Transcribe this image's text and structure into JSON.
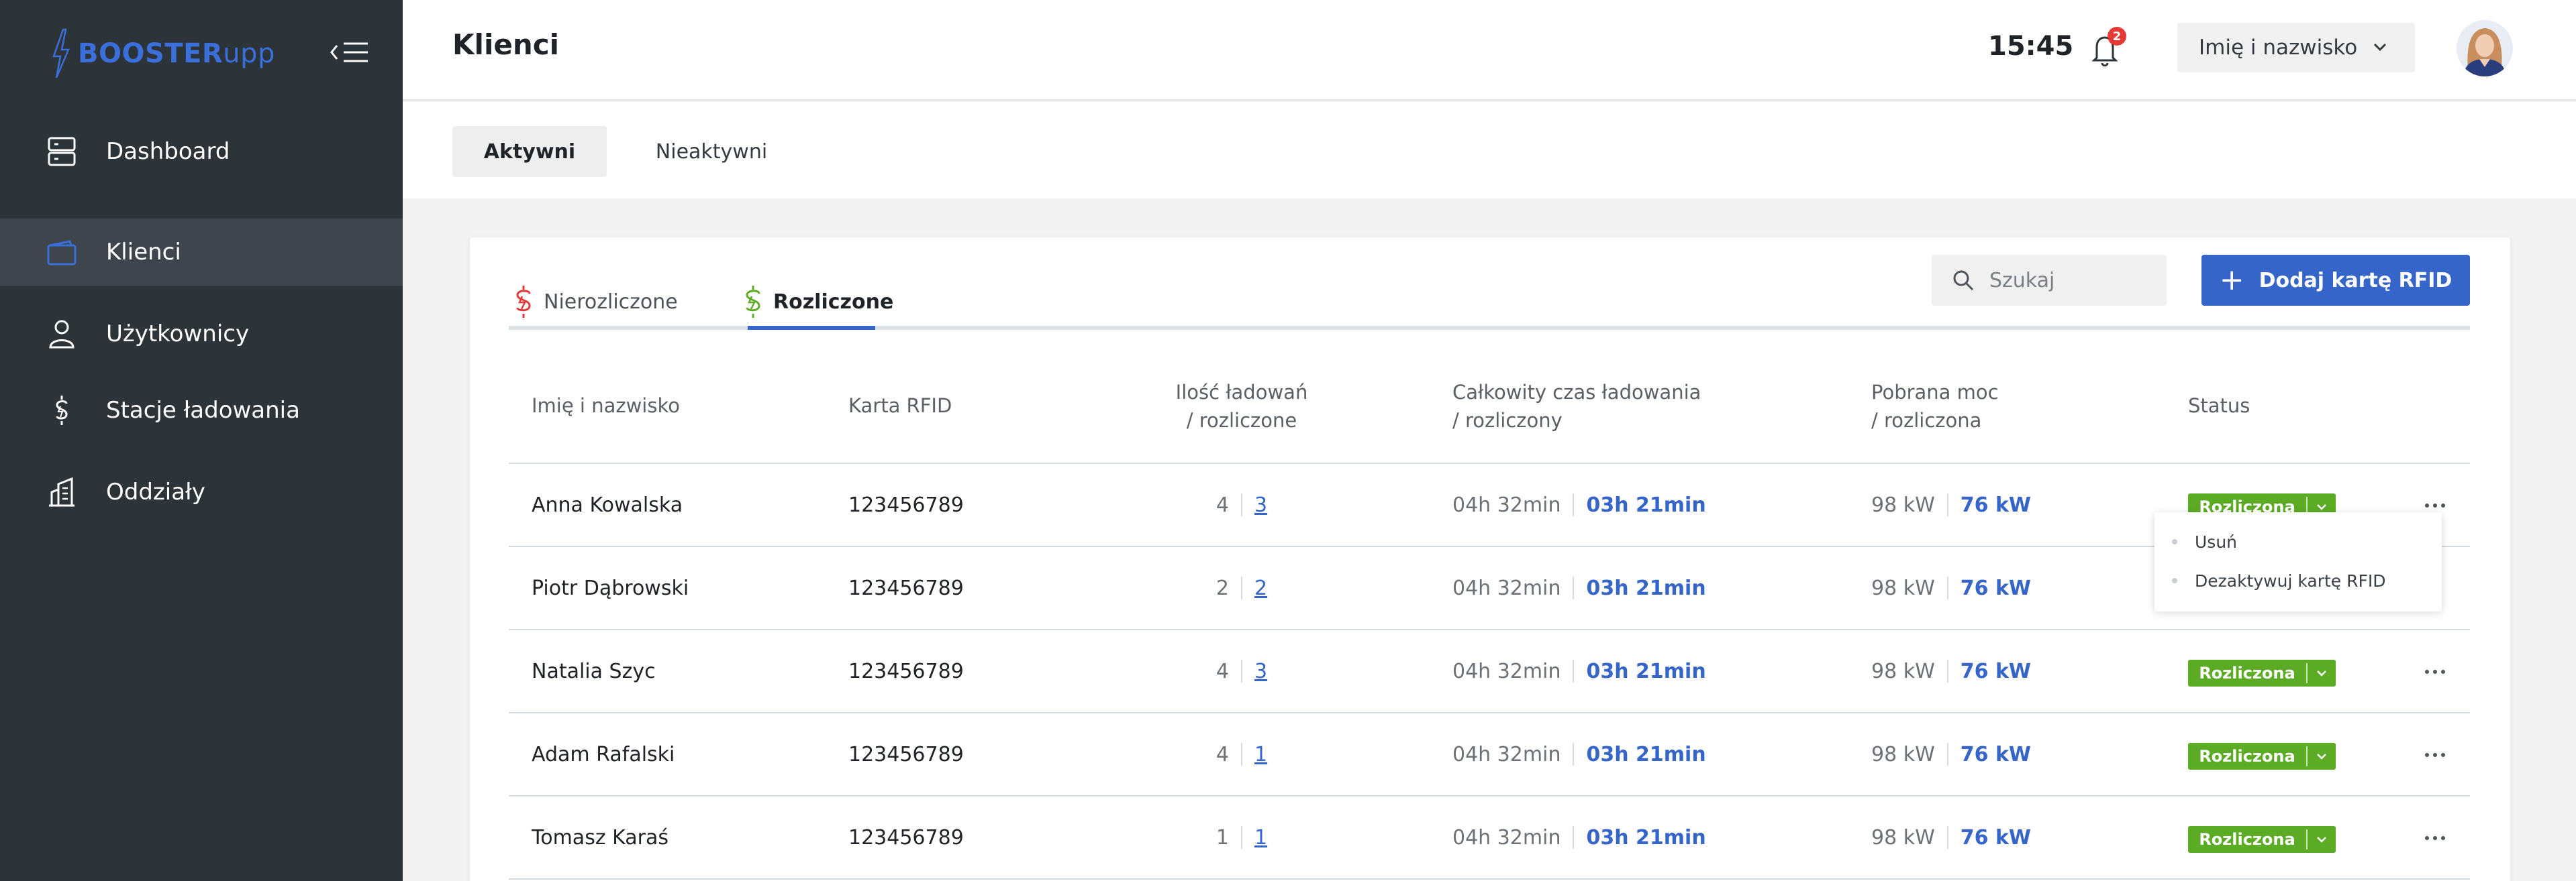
{
  "app": {
    "logo_bold": "BOOSTER",
    "logo_light": "upp"
  },
  "sidebar": {
    "items": [
      {
        "label": "Dashboard",
        "icon": "dashboard-icon"
      },
      {
        "label": "Klienci",
        "icon": "wallet-icon",
        "active": true
      },
      {
        "label": "Użytkownicy",
        "icon": "user-icon"
      },
      {
        "label": "Stacje ładowania",
        "icon": "charging-station-icon"
      },
      {
        "label": "Oddziały",
        "icon": "building-icon"
      }
    ]
  },
  "header": {
    "title": "Klienci",
    "time": "15:45",
    "notification_count": "2",
    "user_select": "Imię i nazwisko"
  },
  "top_tabs": [
    "Aktywni",
    "Nieaktywni"
  ],
  "sub_tabs": [
    {
      "label": "Nierozliczone",
      "icon": "unsettled-money-icon",
      "color": "#e03a3a"
    },
    {
      "label": "Rozliczone",
      "icon": "settled-money-icon",
      "color": "#5cab25",
      "active": true
    }
  ],
  "search": {
    "placeholder": "Szukaj"
  },
  "add_button": {
    "label": "Dodaj kartę RFID"
  },
  "table": {
    "headers": {
      "name": "Imię i nazwisko",
      "rfid": "Karta RFID",
      "count_1": "Ilość ładowań",
      "count_2": "/ rozliczone",
      "time_1": "Całkowity czas ładowania",
      "time_2": "/ rozliczony",
      "power_1": "Pobrana moc",
      "power_2": "/ rozliczona",
      "status": "Status"
    },
    "rows": [
      {
        "name": "Anna Kowalska",
        "rfid": "123456789",
        "count": "4",
        "settled": "3",
        "time": "04h 32min",
        "time_settled": "03h 21min",
        "power": "98 kW",
        "power_settled": "76 kW",
        "status": "Rozliczona"
      },
      {
        "name": "Piotr Dąbrowski",
        "rfid": "123456789",
        "count": "2",
        "settled": "2",
        "time": "04h 32min",
        "time_settled": "03h 21min",
        "power": "98 kW",
        "power_settled": "76 kW",
        "status": "Rozliczona"
      },
      {
        "name": "Natalia Szyc",
        "rfid": "123456789",
        "count": "4",
        "settled": "3",
        "time": "04h 32min",
        "time_settled": "03h 21min",
        "power": "98 kW",
        "power_settled": "76 kW",
        "status": "Rozliczona"
      },
      {
        "name": "Adam Rafalski",
        "rfid": "123456789",
        "count": "4",
        "settled": "1",
        "time": "04h 32min",
        "time_settled": "03h 21min",
        "power": "98 kW",
        "power_settled": "76 kW",
        "status": "Rozliczona"
      },
      {
        "name": "Tomasz Karaś",
        "rfid": "123456789",
        "count": "1",
        "settled": "1",
        "time": "04h 32min",
        "time_settled": "03h 21min",
        "power": "98 kW",
        "power_settled": "76 kW",
        "status": "Rozliczona"
      }
    ]
  },
  "row_menu": {
    "items": [
      "Usuń",
      "Dezaktywuj kartę RFID"
    ]
  },
  "colors": {
    "accent": "#3565c8",
    "status_green": "#5cab25",
    "sidebar_bg": "#2c3339",
    "badge_red": "#e53935"
  }
}
